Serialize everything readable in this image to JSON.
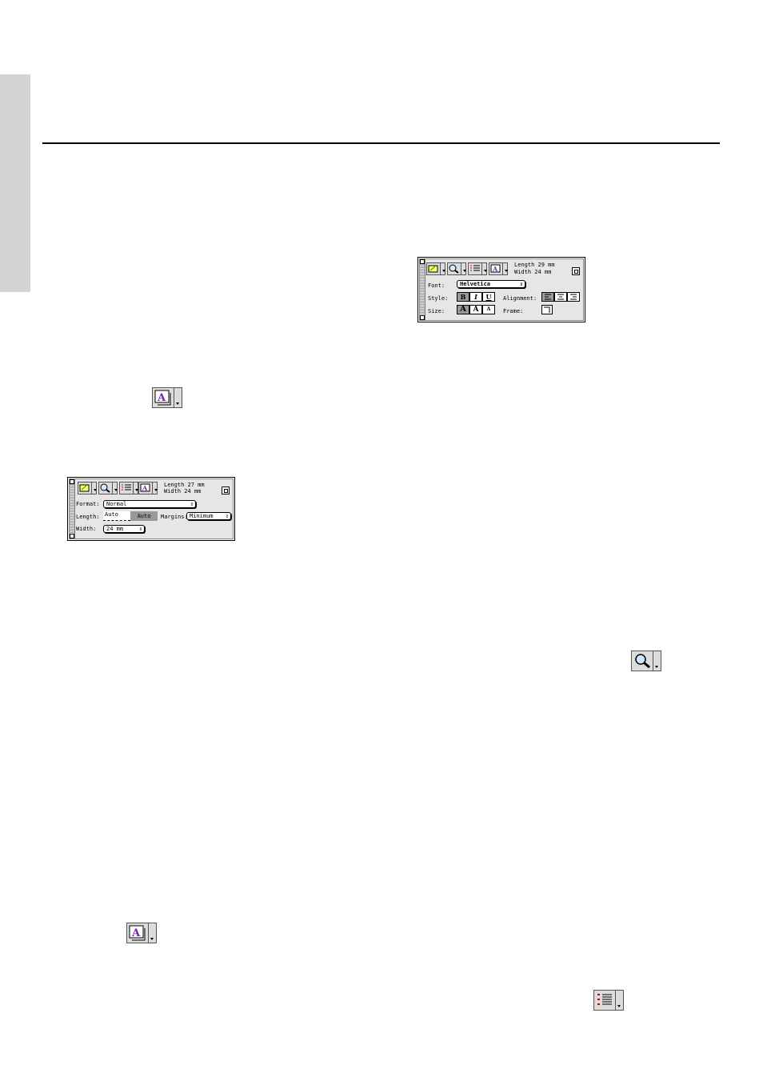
{
  "palette1": {
    "length_text": "Length  27 mm",
    "width_text": "Width 24 mm",
    "format_label": "Format:",
    "format_value": "Normal",
    "length_label": "Length:",
    "length_field": "Auto",
    "length_button": "Auto",
    "margins_label": "Margins:",
    "margins_value": "Minimum",
    "width_label": "Width:",
    "width_value": "24 mm"
  },
  "palette2": {
    "length_text": "Length  29 mm",
    "width_text": "Width 24 mm",
    "font_label": "Font:",
    "font_value": "Helvetica",
    "style_label": "Style:",
    "bold": "B",
    "italic": "I",
    "underline": "U",
    "alignment_label": "Alignment:",
    "size_label": "Size:",
    "size_large": "A",
    "size_medium": "A",
    "size_small": "A",
    "frame_label": "Frame:"
  },
  "icons": {
    "text_format": "text-format-icon",
    "zoom": "magnifier-icon",
    "layout": "layout-list-icon",
    "colors": {
      "purple": "#7a1fb0",
      "highlight": "#ffff66",
      "red": "#cc0000"
    }
  }
}
